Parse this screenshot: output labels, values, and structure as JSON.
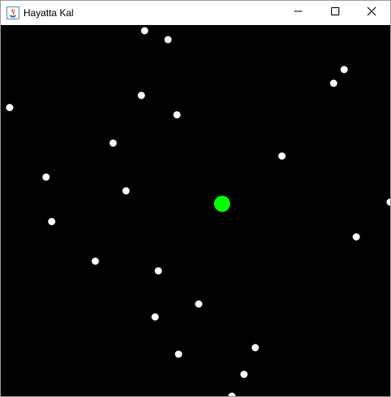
{
  "window": {
    "title": "Hayatta Kal",
    "icon": "java-icon",
    "controls": [
      "minimize-icon",
      "maximize-icon",
      "close-icon"
    ]
  },
  "game": {
    "background_color": "#000000",
    "player_color": "#00ff00",
    "enemy_color": "#ffffff"
  }
}
